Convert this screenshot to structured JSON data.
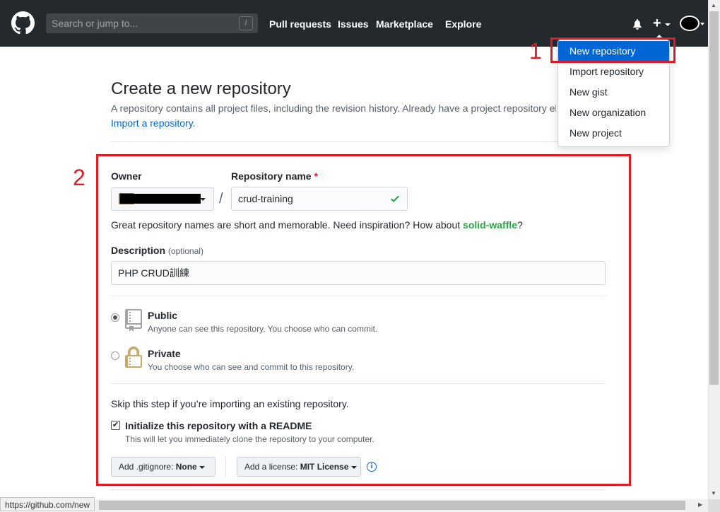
{
  "header": {
    "search_placeholder": "Search or jump to...",
    "search_shortcut": "/",
    "nav": [
      "Pull requests",
      "Issues",
      "Marketplace",
      "Explore"
    ]
  },
  "new_menu": {
    "items": [
      "New repository",
      "Import repository",
      "New gist",
      "New organization",
      "New project"
    ],
    "active_index": 0
  },
  "page": {
    "title": "Create a new repository",
    "subtitle": "A repository contains all project files, including the revision history. Already have a project repository elsewhere?",
    "import_link": "Import a repository."
  },
  "form": {
    "owner_label": "Owner",
    "repo_name_label": "Repository name",
    "required_mark": "*",
    "separator": "/",
    "repo_name_value": "crud-training",
    "name_hint_prefix": "Great repository names are short and memorable. Need inspiration? How about ",
    "name_hint_suggestion": "solid-waffle",
    "name_hint_suffix": "?",
    "description_label": "Description",
    "description_optional": "(optional)",
    "description_value": "PHP CRUD訓練",
    "visibility": {
      "public_title": "Public",
      "public_note": "Anyone can see this repository. You choose who can commit.",
      "private_title": "Private",
      "private_note": "You choose who can see and commit to this repository.",
      "selected": "public"
    },
    "skip_note": "Skip this step if you’re importing an existing repository.",
    "readme_title": "Initialize this repository with a README",
    "readme_note": "This will let you immediately clone the repository to your computer.",
    "readme_checked": true,
    "gitignore_prefix": "Add .gitignore: ",
    "gitignore_value": "None",
    "license_prefix": "Add a license: ",
    "license_value": "MIT License",
    "info_symbol": "i"
  },
  "annotations": {
    "marker_1": "1",
    "marker_2": "2"
  },
  "status_bar": {
    "url": "https://github.com/new"
  },
  "colors": {
    "header_bg": "#24292e",
    "link": "#0366d6",
    "annotation_red": "#e01b24",
    "success_green": "#28a745"
  }
}
